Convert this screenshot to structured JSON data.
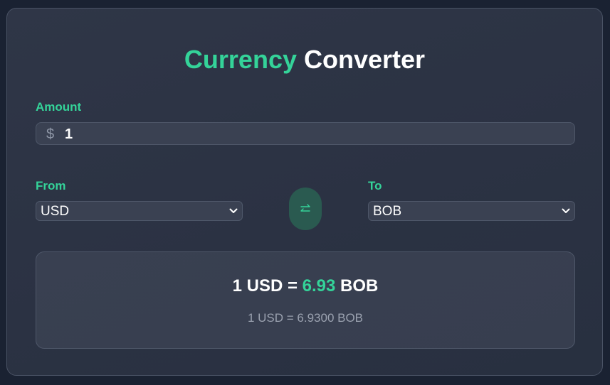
{
  "title": {
    "accent_word": "Currency",
    "rest": "Converter"
  },
  "amount": {
    "label": "Amount",
    "symbol": "$",
    "value": "1"
  },
  "from": {
    "label": "From",
    "selected": "USD"
  },
  "to": {
    "label": "To",
    "selected": "BOB"
  },
  "swap": {
    "icon": "swap-arrows-icon"
  },
  "result": {
    "main_prefix": "1 USD =",
    "main_rate": "6.93",
    "main_suffix": "BOB",
    "detail": "1 USD = 6.9300 BOB"
  },
  "colors": {
    "accent": "#34d399",
    "card_bg": "#2f3647",
    "page_bg": "#1a2232",
    "swap_bg": "#2a5a50"
  }
}
